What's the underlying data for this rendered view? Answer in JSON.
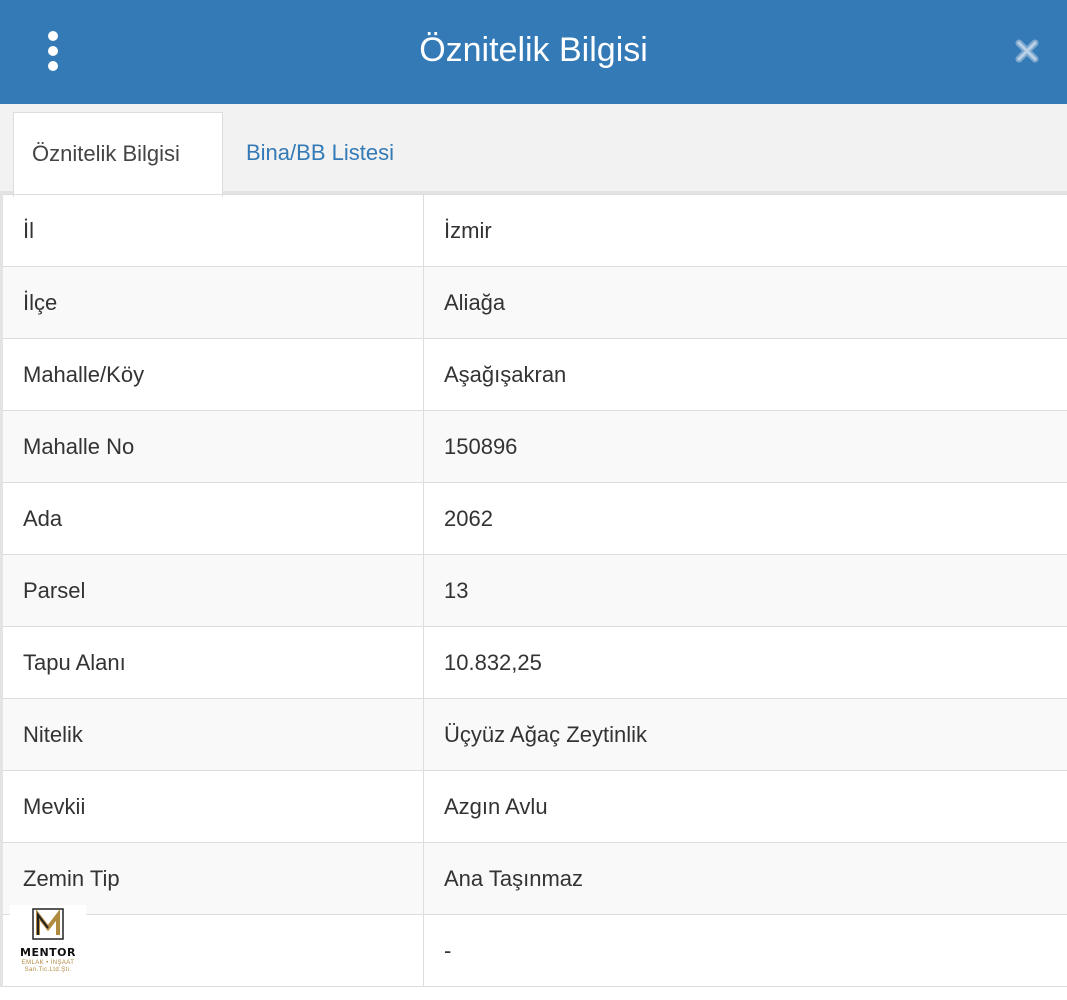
{
  "colors": {
    "header_bg": "#337ab7",
    "tab_bar_bg": "#f2f2f2",
    "link": "#337ab7",
    "logo_gold": "#b08a3e"
  },
  "header": {
    "menu_icon": "kebab-menu-icon",
    "title": "Öznitelik Bilgisi",
    "close_icon": "close-icon"
  },
  "tabs": [
    {
      "label": "Öznitelik Bilgisi",
      "active": true
    },
    {
      "label": "Bina/BB Listesi",
      "active": false
    }
  ],
  "rows": [
    {
      "key": "İl",
      "value": "İzmir"
    },
    {
      "key": "İlçe",
      "value": "Aliağa"
    },
    {
      "key": "Mahalle/Köy",
      "value": "Aşağışakran"
    },
    {
      "key": "Mahalle No",
      "value": "150896"
    },
    {
      "key": "Ada",
      "value": "2062"
    },
    {
      "key": "Parsel",
      "value": "13"
    },
    {
      "key": "Tapu Alanı",
      "value": "10.832,25"
    },
    {
      "key": "Nitelik",
      "value": "Üçyüz Ağaç Zeytinlik"
    },
    {
      "key": "Mevkii",
      "value": "Azgın Avlu"
    },
    {
      "key": "Zemin Tip",
      "value": "Ana Taşınmaz"
    },
    {
      "key": "",
      "value": "-"
    }
  ],
  "watermark": {
    "name": "MENTOR",
    "line1": "EMLAK • İNŞAAT",
    "line2": "San.Tic.Ltd.Şti."
  }
}
